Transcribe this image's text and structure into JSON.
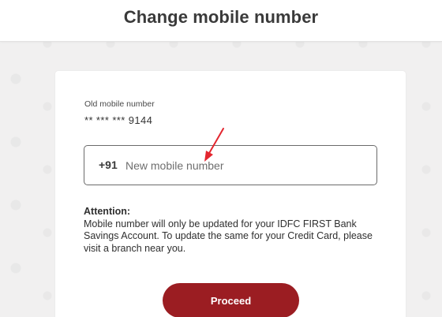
{
  "header": {
    "title": "Change mobile number"
  },
  "old_number": {
    "label": "Old mobile number",
    "value": "** *** *** 9144"
  },
  "new_number": {
    "country_code": "+91",
    "placeholder": "New mobile number",
    "value": ""
  },
  "attention": {
    "title": "Attention:",
    "message": "Mobile number will only be updated for your IDFC FIRST Bank Savings Account. To update the same for your Credit Card, please visit a branch near you."
  },
  "actions": {
    "proceed_label": "Proceed"
  },
  "colors": {
    "brand": "#9b1d22",
    "annotation": "#e3262f"
  }
}
